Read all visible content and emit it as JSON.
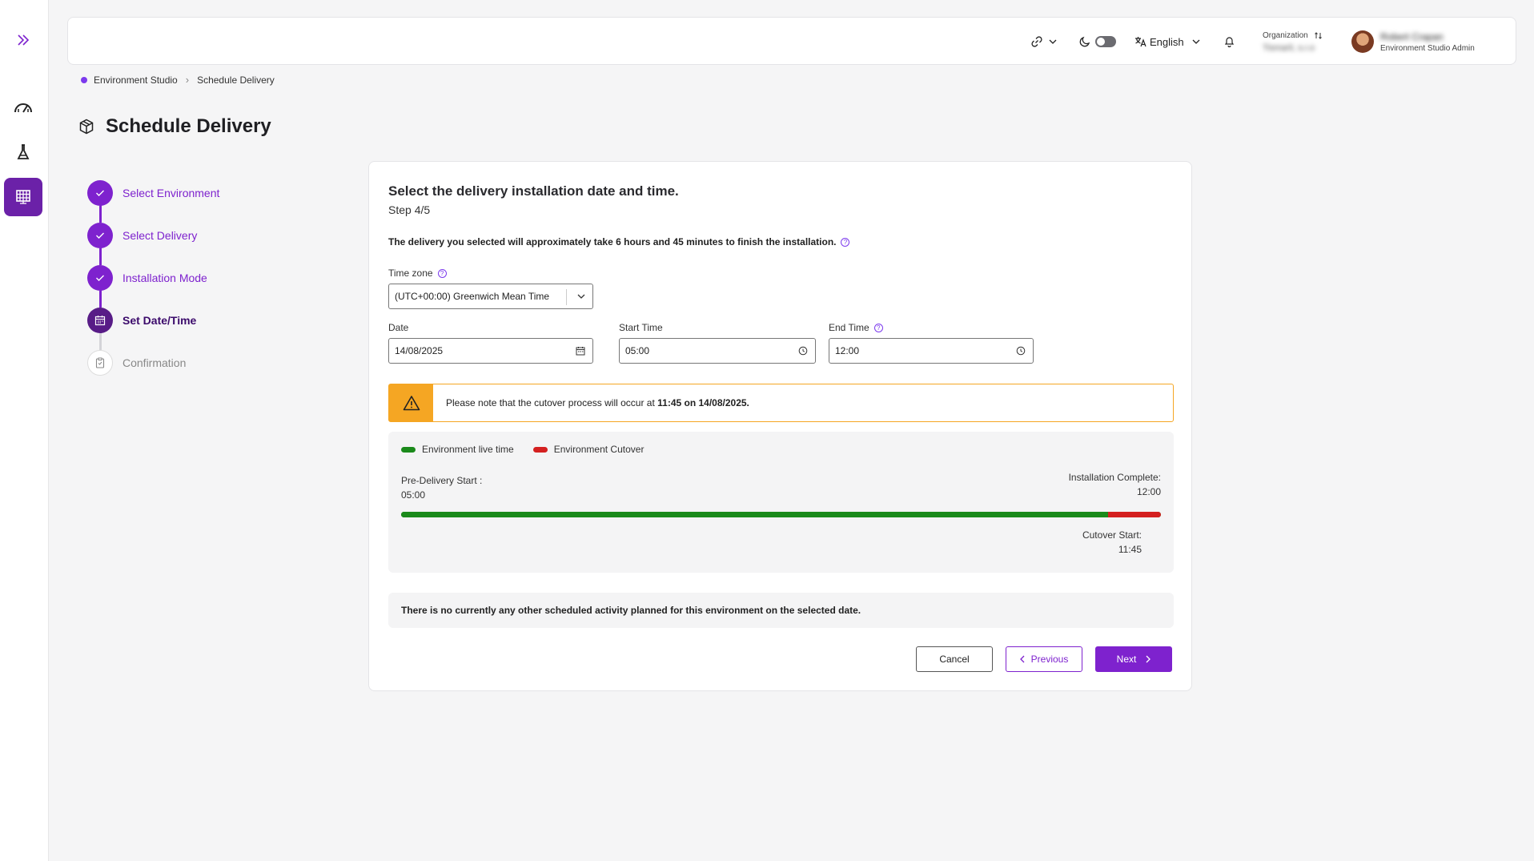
{
  "header": {
    "language": "English",
    "org_label": "Organization",
    "org_name": "Tismarli, s.r.o",
    "user_name": "Robert Crapan",
    "user_role": "Environment Studio Admin"
  },
  "breadcrumb": {
    "root": "Environment Studio",
    "current": "Schedule Delivery"
  },
  "page": {
    "title": "Schedule Delivery"
  },
  "stepper": {
    "steps": [
      {
        "label": "Select Environment",
        "state": "done"
      },
      {
        "label": "Select Delivery",
        "state": "done"
      },
      {
        "label": "Installation Mode",
        "state": "done"
      },
      {
        "label": "Set Date/Time",
        "state": "current"
      },
      {
        "label": "Confirmation",
        "state": "todo"
      }
    ]
  },
  "card": {
    "title": "Select the delivery installation  date and time.",
    "step": "Step 4/5",
    "note": "The delivery you selected will approximately take 6 hours and 45 minutes to finish the installation.",
    "timezone_label": "Time zone",
    "timezone_value": "(UTC+00:00) Greenwich Mean Time",
    "date_label": "Date",
    "date_value": "14/08/2025",
    "start_label": "Start Time",
    "start_value": "05:00",
    "end_label": "End Time",
    "end_value": "12:00",
    "alert_prefix": "Please note that the cutover process will occur at ",
    "alert_bold": "11:45 on 14/08/2025."
  },
  "timeline": {
    "legend_live": "Environment live time",
    "legend_cutover": "Environment Cutover",
    "pre_delivery_label": "Pre-Delivery Start :",
    "pre_delivery_time": "05:00",
    "install_complete_label": "Installation Complete:",
    "install_complete_time": "12:00",
    "cutover_label": "Cutover Start:",
    "cutover_time": "11:45",
    "live_fraction": 0.93,
    "colors": {
      "live": "#1b8a1b",
      "cutover": "#d42020"
    }
  },
  "info_text": "There is no currently any other scheduled activity planned for this environment on the selected date.",
  "buttons": {
    "cancel": "Cancel",
    "previous": "Previous",
    "next": "Next"
  },
  "colors": {
    "accent": "#7e22ce",
    "warning": "#f5a623"
  }
}
